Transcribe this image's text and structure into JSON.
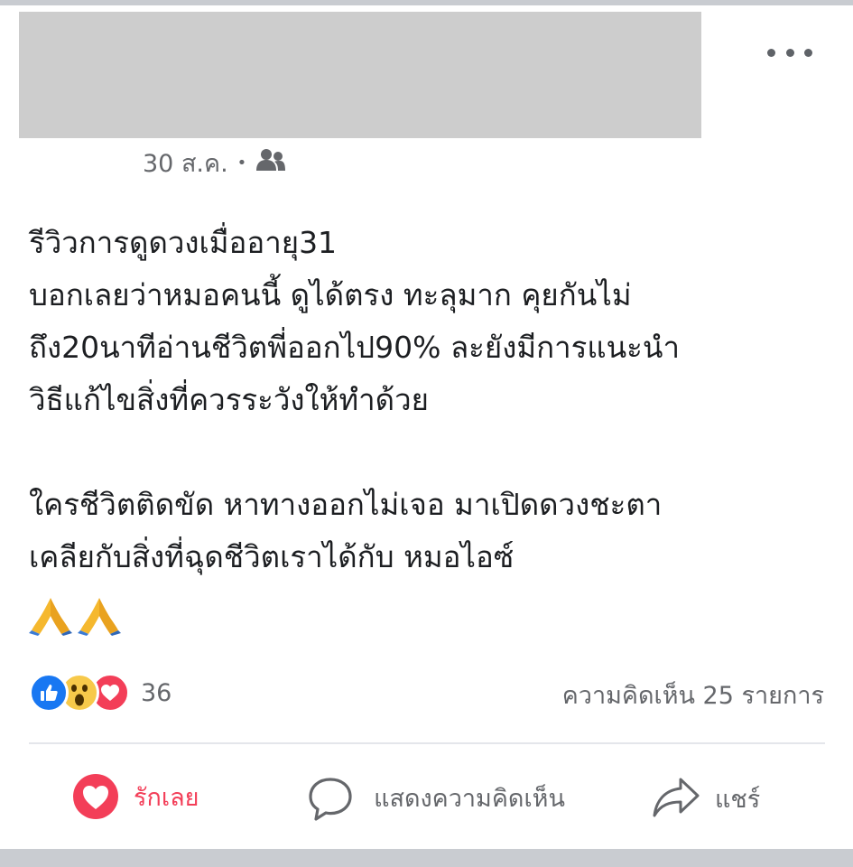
{
  "header": {
    "date": "30 ส.ค.",
    "separator": "•",
    "privacy_icon": "friends-icon",
    "more_icon": "more-horizontal-icon"
  },
  "post": {
    "lines": [
      "รีวิวการดูดวงเมื่ออายุ31",
      "บอกเลยว่าหมอคนนี้ ดูได้ตรง ทะลุมาก คุยกันไม่",
      "ถึง20นาทีอ่านชีวิตพี่ออกไป90% ละยังมีการแนะนำ",
      "วิธีแก้ไขสิ่งที่ควรระวังให้ทำด้วย",
      "ใครชีวิตติดขัด หาทางออกไม่เจอ มาเปิดดวงชะตา",
      "เคลียกับสิ่งที่ฉุดชีวิตเราได้กับ หมอไอซ์"
    ],
    "emoji": [
      "🙏",
      "🙏"
    ]
  },
  "reactions": {
    "icons": [
      "like-icon",
      "wow-icon",
      "love-icon"
    ],
    "count": "36",
    "comments": "ความคิดเห็น 25 รายการ"
  },
  "actions": {
    "love_label": "รักเลย",
    "comment_label": "แสดงความคิดเห็น",
    "share_label": "แชร์"
  },
  "colors": {
    "love": "#f33e58",
    "like": "#1877f2",
    "wow": "#f7c94a",
    "muted": "#65676b"
  }
}
